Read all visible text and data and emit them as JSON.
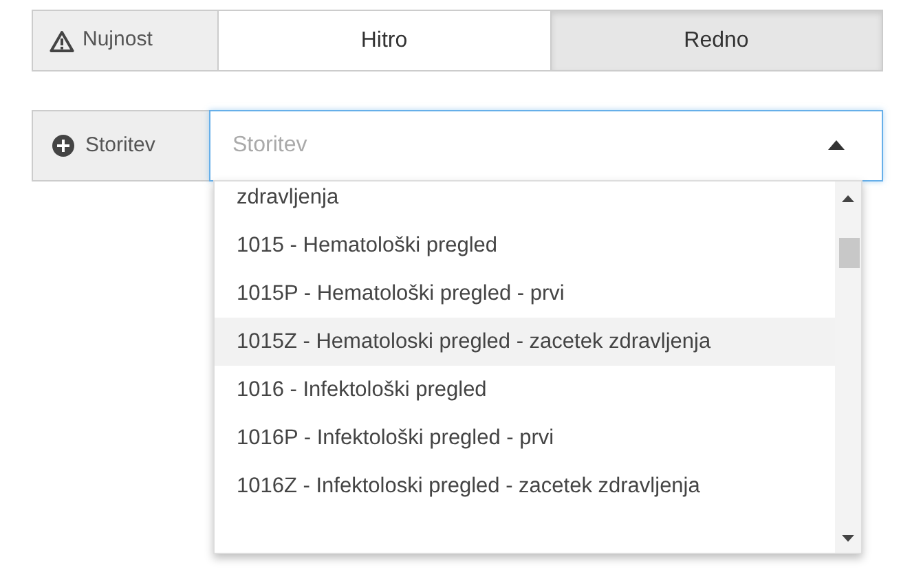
{
  "urgency": {
    "label": "Nujnost",
    "options": [
      {
        "label": "Hitro",
        "selected": false
      },
      {
        "label": "Redno",
        "selected": true
      }
    ]
  },
  "service": {
    "label": "Storitev",
    "placeholder": "Storitev",
    "expanded": true,
    "options": [
      {
        "label": "zdravljenja",
        "highlighted": false
      },
      {
        "label": "1015 - Hematološki pregled",
        "highlighted": false
      },
      {
        "label": "1015P - Hematološki pregled - prvi",
        "highlighted": false
      },
      {
        "label": "1015Z - Hematoloski pregled - zacetek zdravljenja",
        "highlighted": true
      },
      {
        "label": "1016 - Infektološki pregled",
        "highlighted": false
      },
      {
        "label": "1016P - Infektološki pregled - prvi",
        "highlighted": false
      },
      {
        "label": "1016Z - Infektoloski pregled - zacetek zdravljenja",
        "highlighted": false
      }
    ]
  }
}
